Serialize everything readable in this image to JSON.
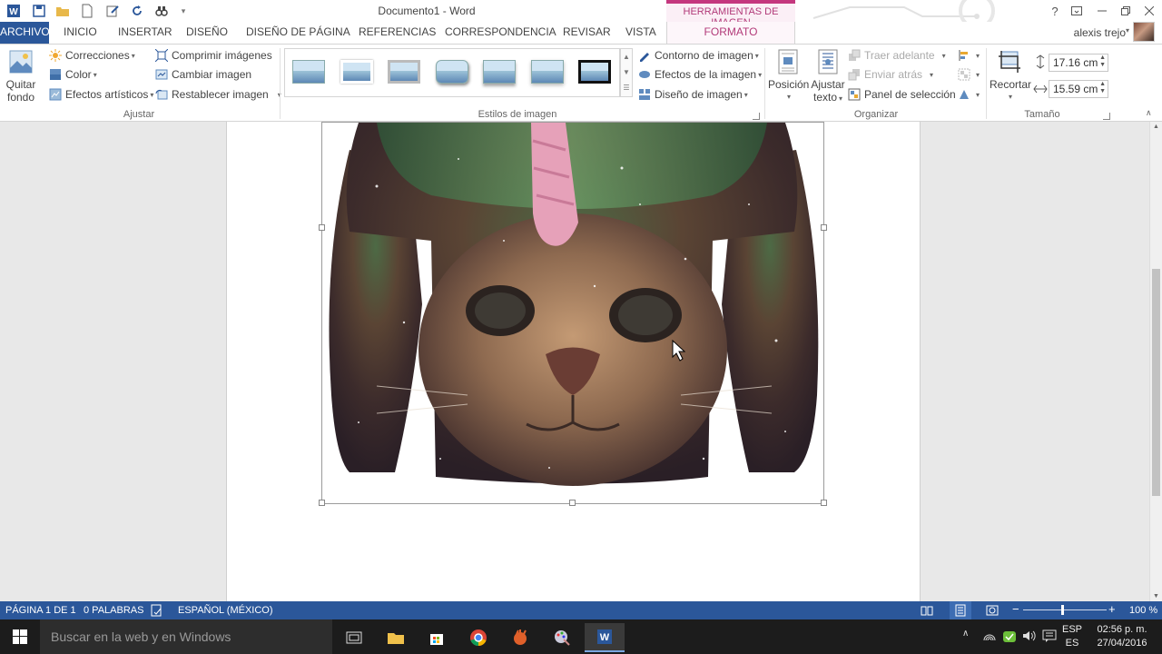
{
  "window": {
    "title": "Documento1 - Word",
    "contextual_header": "HERRAMIENTAS DE IMAGEN",
    "help": "?"
  },
  "tabs": [
    {
      "label": "ARCHIVO"
    },
    {
      "label": "INICIO"
    },
    {
      "label": "INSERTAR"
    },
    {
      "label": "DISEÑO"
    },
    {
      "label": "DISEÑO DE PÁGINA"
    },
    {
      "label": "REFERENCIAS"
    },
    {
      "label": "CORRESPONDENCIA"
    },
    {
      "label": "REVISAR"
    },
    {
      "label": "VISTA"
    },
    {
      "label": "FORMATO"
    }
  ],
  "user": {
    "name": "alexis trejo"
  },
  "ribbon": {
    "ajustar": {
      "label": "Ajustar",
      "quitar_fondo_line1": "Quitar",
      "quitar_fondo_line2": "fondo",
      "correcciones": "Correcciones",
      "color": "Color",
      "efectos_artisticos": "Efectos artísticos",
      "comprimir": "Comprimir imágenes",
      "cambiar": "Cambiar imagen",
      "restablecer": "Restablecer imagen"
    },
    "estilos": {
      "label": "Estilos de imagen",
      "contorno": "Contorno de imagen",
      "efectos": "Efectos de la imagen",
      "diseno": "Diseño de imagen"
    },
    "organizar": {
      "label": "Organizar",
      "posicion": "Posición",
      "ajustar_line1": "Ajustar",
      "ajustar_line2": "texto",
      "traer_adelante": "Traer adelante",
      "enviar_atras": "Enviar atrás",
      "panel_seleccion": "Panel de selección"
    },
    "tamano": {
      "label": "Tamaño",
      "recortar": "Recortar",
      "height": "17.16 cm",
      "width": "15.59 cm"
    }
  },
  "status": {
    "page": "PÁGINA 1 DE 1",
    "words": "0 PALABRAS",
    "language": "ESPAÑOL (MÉXICO)",
    "zoom": "100 %"
  },
  "taskbar": {
    "search_placeholder": "Buscar en la web y en Windows",
    "lang_line1": "ESP",
    "lang_line2": "ES",
    "time": "02:56 p. m.",
    "date": "27/04/2016"
  },
  "colors": {
    "word_blue": "#2b579a",
    "picture_tools": "#b23a79"
  }
}
